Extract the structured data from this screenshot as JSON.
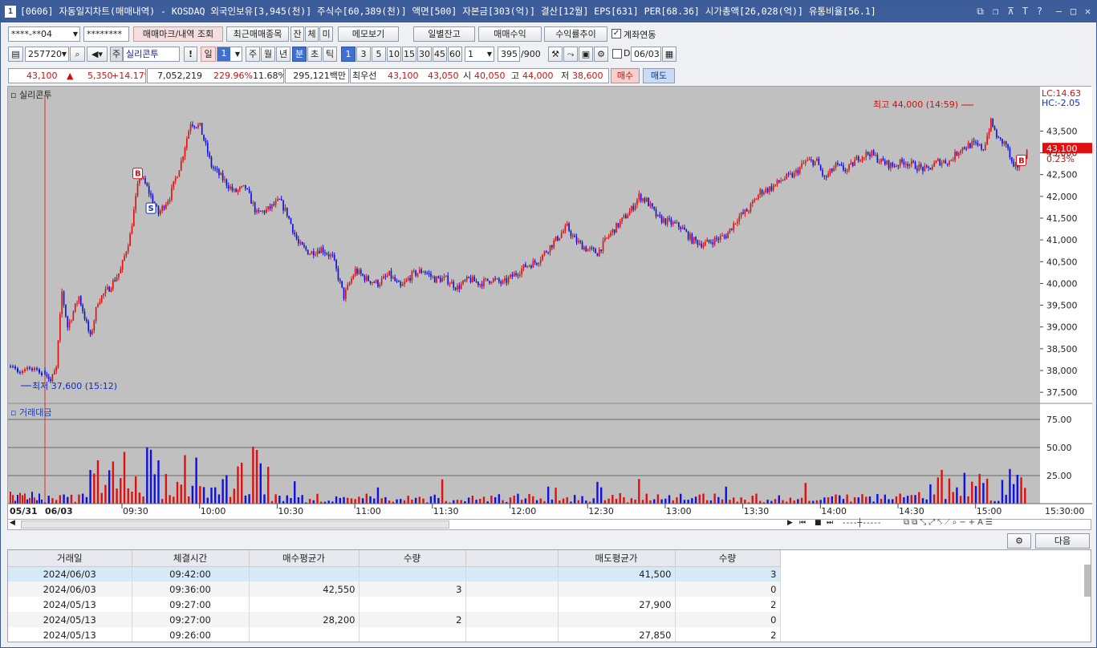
{
  "window": {
    "num": "1",
    "title": "[0606] 자동일지차트(매매내역) - KOSDAQ 외국인보유[3,945(천)] 주식수[60,389(천)] 액면[500] 자본금[303(억)] 결산[12월] EPS[631] PER[68.36] 시가총액[26,028(억)] 유통비율[56.1]",
    "controls": [
      "⧉",
      "❐",
      "⊼",
      "T",
      "?",
      "—",
      "□",
      "✕"
    ]
  },
  "toolbar1": {
    "account": "****-**04",
    "password": "********",
    "trade_mark_btn": "매매마크/내역 조회",
    "recent_btn": "최근매매종목",
    "tabs": [
      "잔",
      "체",
      "미"
    ],
    "memo_btn": "메모보기",
    "daily_balance_btn": "일별잔고",
    "trade_profit_btn": "매매수익",
    "return_trend_btn": "수익률추이",
    "account_link_label": "계좌연동",
    "account_link_checked": true
  },
  "toolbar2": {
    "code": "257720",
    "stock_badge": "주",
    "stock_name": "실리콘투",
    "excl": "!",
    "period_day": "일",
    "period_num": "1",
    "periods": [
      "주",
      "월",
      "년",
      "분",
      "초",
      "틱"
    ],
    "intervals": [
      "1",
      "3",
      "5",
      "10",
      "15",
      "30",
      "45",
      "60"
    ],
    "active_interval": "1",
    "interval_input": "1",
    "count": "395",
    "count_max": "/900",
    "d_label": "D",
    "date": "06/03"
  },
  "quote": {
    "price": "43,100",
    "arrow": "▲",
    "change": "5,350",
    "change_pct": "+14.17%",
    "volume": "7,052,219",
    "vol_ratio": "229.96%",
    "turnover": "11.68%",
    "amount": "295,121백만",
    "best_label": "최우선",
    "ask": "43,100",
    "bid": "43,050",
    "open_label": "시",
    "open": "40,050",
    "high_label": "고",
    "high": "44,000",
    "low_label": "저",
    "low": "38,600",
    "buy_btn": "매수",
    "sell_btn": "매도"
  },
  "chart": {
    "price_pane_title": "실리콘투",
    "volume_pane_title": "거래대금",
    "lc_label": "LC:14.63",
    "hc_label": "HC:-2.05",
    "last_price_tag": "43,100",
    "last_pct_tag": "0.23%",
    "high_annotation": "최고 44,000 (14:59)",
    "low_annotation": "최저 37,600 (15:12)",
    "right_time_label": "15:30:00",
    "colors": {
      "up": "#e01010",
      "down": "#1010e0",
      "bg": "#c0c0c0"
    }
  },
  "chart_data": {
    "type": "candlestick",
    "x_date_labels": [
      "05/31",
      "06/03"
    ],
    "x_time_labels": [
      "09:30",
      "10:00",
      "10:30",
      "11:00",
      "11:30",
      "12:00",
      "12:30",
      "13:00",
      "13:30",
      "14:00",
      "14:30",
      "15:00"
    ],
    "price_ticks": [
      "43,500",
      "43,000",
      "42,500",
      "42,000",
      "41,500",
      "41,000",
      "40,500",
      "40,000",
      "39,500",
      "39,000",
      "38,500",
      "38,000",
      "37,500"
    ],
    "price_range": [
      37300,
      44300
    ],
    "volume_ticks": [
      "75.00",
      "50.00",
      "25.00"
    ],
    "volume_range": [
      0,
      80
    ],
    "price_path": [
      [
        0,
        38000
      ],
      [
        3,
        37750
      ],
      [
        6,
        38050
      ],
      [
        9,
        39800
      ],
      [
        12,
        39000
      ],
      [
        18,
        39700
      ],
      [
        24,
        38750
      ],
      [
        28,
        39600
      ],
      [
        34,
        39900
      ],
      [
        40,
        40300
      ],
      [
        45,
        41100
      ],
      [
        50,
        42500
      ],
      [
        54,
        42200
      ],
      [
        60,
        41600
      ],
      [
        66,
        42000
      ],
      [
        72,
        42800
      ],
      [
        77,
        43700
      ],
      [
        82,
        43600
      ],
      [
        88,
        42700
      ],
      [
        94,
        42400
      ],
      [
        100,
        42100
      ],
      [
        106,
        42200
      ],
      [
        112,
        41600
      ],
      [
        118,
        41700
      ],
      [
        124,
        41900
      ],
      [
        128,
        41600
      ],
      [
        134,
        40900
      ],
      [
        140,
        40700
      ],
      [
        146,
        40800
      ],
      [
        152,
        40600
      ],
      [
        158,
        39700
      ],
      [
        164,
        40300
      ],
      [
        170,
        40100
      ],
      [
        176,
        40000
      ],
      [
        182,
        40200
      ],
      [
        188,
        39900
      ],
      [
        194,
        40200
      ],
      [
        200,
        40300
      ],
      [
        206,
        40100
      ],
      [
        212,
        40100
      ],
      [
        218,
        39900
      ],
      [
        224,
        40100
      ],
      [
        230,
        40000
      ],
      [
        236,
        40100
      ],
      [
        242,
        40000
      ],
      [
        248,
        40200
      ],
      [
        254,
        40400
      ],
      [
        260,
        40500
      ],
      [
        266,
        40800
      ],
      [
        272,
        41100
      ],
      [
        276,
        41300
      ],
      [
        280,
        41000
      ],
      [
        286,
        40800
      ],
      [
        292,
        40700
      ],
      [
        298,
        41100
      ],
      [
        304,
        41400
      ],
      [
        310,
        41700
      ],
      [
        314,
        42000
      ],
      [
        318,
        41900
      ],
      [
        324,
        41500
      ],
      [
        330,
        41400
      ],
      [
        336,
        41300
      ],
      [
        342,
        41000
      ],
      [
        348,
        40900
      ],
      [
        354,
        41000
      ],
      [
        360,
        41100
      ],
      [
        366,
        41500
      ],
      [
        372,
        41700
      ],
      [
        378,
        42100
      ],
      [
        384,
        42200
      ],
      [
        390,
        42400
      ],
      [
        396,
        42500
      ],
      [
        402,
        42800
      ],
      [
        408,
        42800
      ],
      [
        412,
        42400
      ],
      [
        418,
        42700
      ],
      [
        424,
        42600
      ],
      [
        430,
        42900
      ],
      [
        436,
        43000
      ],
      [
        442,
        42800
      ],
      [
        448,
        42700
      ],
      [
        454,
        42800
      ],
      [
        460,
        42700
      ],
      [
        466,
        42600
      ],
      [
        472,
        42800
      ],
      [
        478,
        42800
      ],
      [
        484,
        43100
      ],
      [
        490,
        43200
      ],
      [
        496,
        43100
      ],
      [
        500,
        43700
      ],
      [
        504,
        43300
      ],
      [
        508,
        43200
      ],
      [
        512,
        42600
      ],
      [
        516,
        42800
      ],
      [
        520,
        43100
      ]
    ],
    "candle_count": 520,
    "trade_marks": [
      {
        "type": "B",
        "index": 49,
        "price": 42500
      },
      {
        "type": "S",
        "index": 56,
        "price": 41700
      },
      {
        "type": "B",
        "index": 516,
        "price": 42800
      }
    ]
  },
  "scroll": {
    "buttons": [
      "◀",
      "▶",
      "⏮",
      "■",
      "⏭"
    ]
  },
  "bottom": {
    "gear": "⚙",
    "next_btn": "다음",
    "headers": [
      "거래일",
      "체결시간",
      "매수평균가",
      "수량",
      "",
      "매도평균가",
      "수량"
    ],
    "rows": [
      [
        "2024/06/03",
        "09:42:00",
        "",
        "",
        "",
        "41,500",
        "3"
      ],
      [
        "2024/06/03",
        "09:36:00",
        "42,550",
        "3",
        "",
        "",
        "0"
      ],
      [
        "2024/05/13",
        "09:27:00",
        "",
        "",
        "",
        "27,900",
        "2"
      ],
      [
        "2024/05/13",
        "09:27:00",
        "28,200",
        "2",
        "",
        "",
        "0"
      ],
      [
        "2024/05/13",
        "09:26:00",
        "",
        "",
        "",
        "27,850",
        "2"
      ]
    ]
  }
}
